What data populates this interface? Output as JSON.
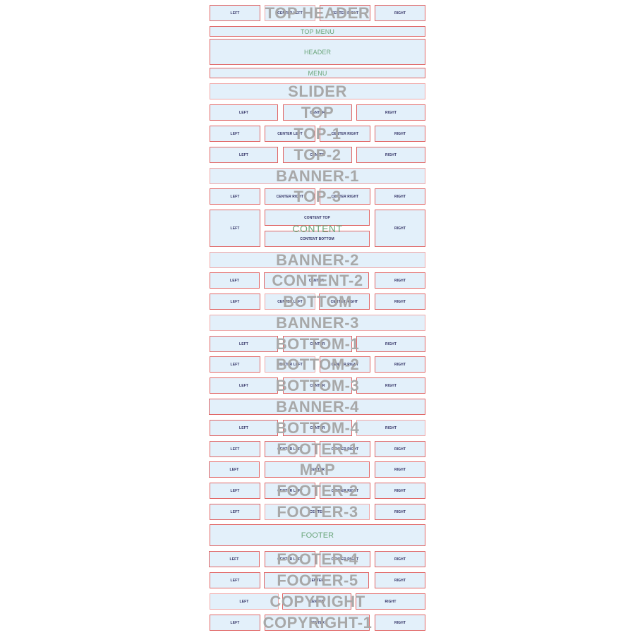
{
  "colors": {
    "box_fill": "#e3f0fa",
    "box_border": "#e06666",
    "section_label": "#a8a8a8",
    "green_label": "#6aa57a",
    "cell_text": "#333366"
  },
  "sections": {
    "top_header": {
      "label": "TOP HEADER",
      "cells": [
        "LEFT",
        "CENTER LEFT",
        "CENTER RIGHT",
        "RIGHT"
      ]
    },
    "top_menu": {
      "label": "TOP MENU"
    },
    "header": {
      "label": "HEADER"
    },
    "menu": {
      "label": "MENU"
    },
    "slider": {
      "label": "SLIDER"
    },
    "top": {
      "label": "TOP",
      "cells": [
        "LEFT",
        "CENTER",
        "RIGHT"
      ]
    },
    "top_1": {
      "label": "TOP-1",
      "cells": [
        "LEFT",
        "CENTER LEFT",
        "CENTER RIGHT",
        "RIGHT"
      ]
    },
    "top_2": {
      "label": "TOP-2",
      "cells": [
        "LEFT",
        "CENTER",
        "RIGHT"
      ]
    },
    "banner_1": {
      "label": "BANNER-1"
    },
    "top_3": {
      "label": "TOP-3",
      "cells": [
        "LEFT",
        "CENTER RIGHT",
        "CENTER RIGHT",
        "RIGHT"
      ]
    },
    "content": {
      "label": "CONTENT",
      "cells": [
        "LEFT",
        "CONTENT TOP",
        "CONTENT BOTTOM",
        "RIGHT"
      ]
    },
    "banner_2": {
      "label": "BANNER-2"
    },
    "content_2": {
      "label": "CONTENT-2",
      "cells": [
        "LEFT",
        "CENTER",
        "RIGHT"
      ]
    },
    "bottom": {
      "label": "BOTTOM",
      "cells": [
        "LEFT",
        "CENTER LEFT",
        "CENTER RIGHT",
        "RIGHT"
      ]
    },
    "banner_3": {
      "label": "BANNER-3"
    },
    "bottom_1": {
      "label": "BOTTOM-1",
      "cells": [
        "LEFT",
        "CENTER",
        "RIGHT"
      ]
    },
    "bottom_2": {
      "label": "BOTTOM-2",
      "cells": [
        "LEFT",
        "CENTER LEFT",
        "CENTER RIGHT",
        "RIGHT"
      ]
    },
    "bottom_3": {
      "label": "BOTTOM-3",
      "cells": [
        "LEFT",
        "CENTER",
        "RIGHT"
      ]
    },
    "banner_4": {
      "label": "BANNER-4"
    },
    "bottom_4": {
      "label": "BOTTOM-4",
      "cells": [
        "LEFT",
        "CENTER",
        "RIGHT"
      ]
    },
    "footer_1": {
      "label": "FOOTER-1",
      "cells": [
        "LEFT",
        "CENTER LEFT",
        "CENTER RIGHT",
        "RIGHT"
      ]
    },
    "map": {
      "label": "MAP",
      "cells": [
        "LEFT",
        "CENTER",
        "RIGHT"
      ]
    },
    "footer_2": {
      "label": "FOOTER-2",
      "cells": [
        "LEFT",
        "CENTER LEFT",
        "CENTER RIGHT",
        "RIGHT"
      ]
    },
    "footer_3": {
      "label": "FOOTER-3",
      "cells": [
        "LEFT",
        "CENTER",
        "RIGHT"
      ]
    },
    "footer": {
      "label": "FOOTER"
    },
    "footer_4": {
      "label": "FOOTER-4",
      "cells": [
        "LEFT",
        "CENTER LEFT",
        "CENTER RIGHT",
        "RIGHT"
      ]
    },
    "footer_5": {
      "label": "FOOTER-5",
      "cells": [
        "LEFT",
        "CENTER",
        "RIGHT"
      ]
    },
    "copyright": {
      "label": "COPYRIGHT",
      "cells": [
        "LEFT",
        "CENTER",
        "RIGHT"
      ]
    },
    "copyright_1": {
      "label": "COPYRIGHT-1",
      "cells": [
        "LEFT",
        "CENTER",
        "RIGHT"
      ]
    }
  }
}
